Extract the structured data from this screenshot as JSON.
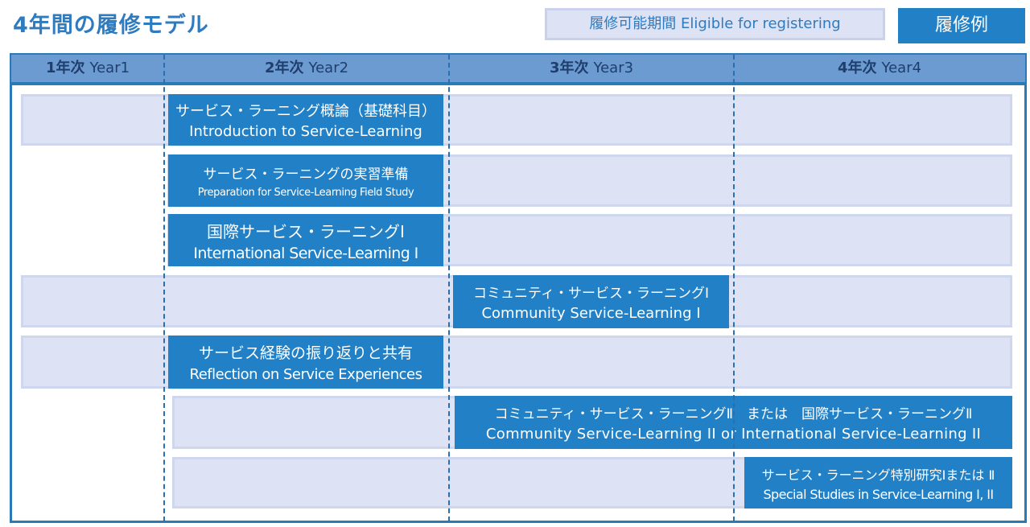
{
  "title": "4年間の履修モデル",
  "legend": {
    "eligible_label": "履修可能期間 Eligible for registering",
    "example_label": "履修例"
  },
  "years": [
    {
      "bold": "1年次",
      "label": "Year1"
    },
    {
      "bold": "2年次",
      "label": "Year2"
    },
    {
      "bold": "3年次",
      "label": "Year3"
    },
    {
      "bold": "4年次",
      "label": "Year4"
    }
  ],
  "courses": [
    {
      "jp": "サービス・ラーニング概論（基礎科目）",
      "en": "Introduction to Service-Learning",
      "year": "2年次"
    },
    {
      "jp": "サービス・ラーニングの実習準備",
      "en": "Preparation for Service-Learning Field Study",
      "year": "2年次"
    },
    {
      "jp": "国際サービス・ラーニングⅠ",
      "en": "International Service-Learning I",
      "year": "2年次"
    },
    {
      "jp": "コミュニティ・サービス・ラーニングⅠ",
      "en": "Community Service-Learning I",
      "year": "3年次"
    },
    {
      "jp": "サービス経験の振り返りと共有",
      "en": "Reflection on Service Experiences",
      "year": "2年次"
    },
    {
      "jp": "コミュニティ・サービス・ラーニングⅡ　または　国際サービス・ラーニングⅡ",
      "en": "Community Service-Learning II or International Service-Learning II",
      "year": "3年次〜4年次"
    },
    {
      "jp": "サービス・ラーニング特別研究Ⅰまたは Ⅱ",
      "en": "Special Studies in Service-Learning I, II",
      "year": "4年次"
    }
  ],
  "colors": {
    "accent": "#2180c6",
    "title": "#2e7bc0",
    "header_bg": "#6b9bd1",
    "eligible_bg": "#dde3f4",
    "frame": "#2a7ab8"
  }
}
